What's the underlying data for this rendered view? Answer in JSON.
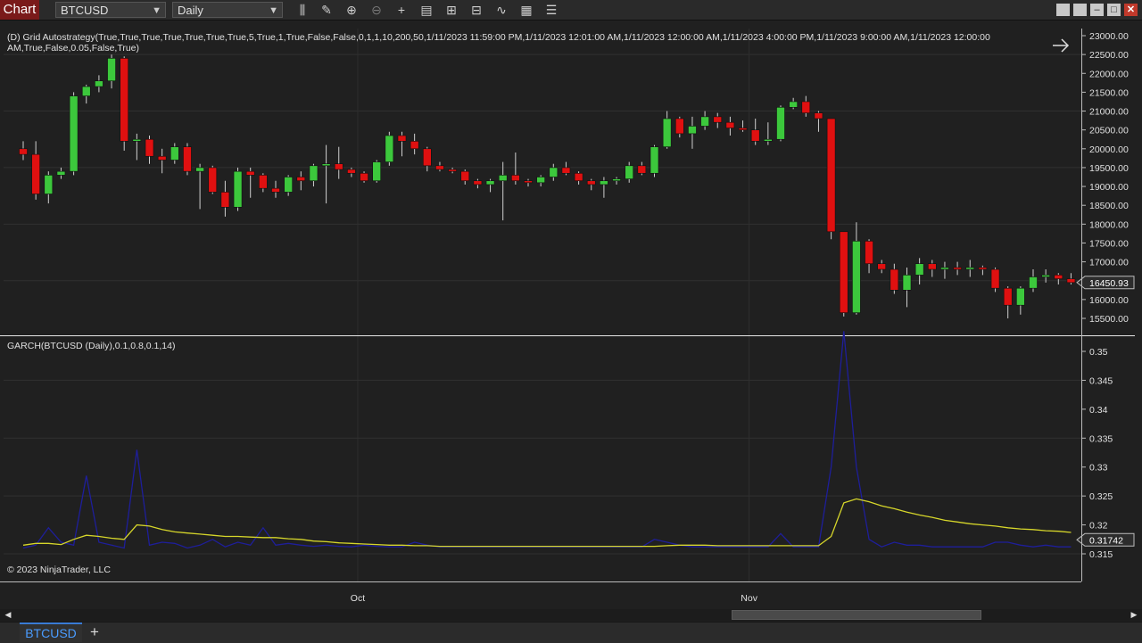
{
  "window": {
    "title": "Chart",
    "instrument": "BTCUSD",
    "interval": "Daily"
  },
  "toolbar": {
    "icons": [
      "bar-type-icon",
      "draw-pencil-icon",
      "zoom-in-icon",
      "zoom-out-icon",
      "crosshair-icon",
      "properties-icon",
      "templates-icon",
      "data-box-icon",
      "indicators-icon",
      "strategies-icon",
      "menu-list-icon"
    ]
  },
  "price_panel": {
    "strategy_label_line1": "(D) Grid Autostrategy(True,True,True,True,True,True,True,5,True,1,True,False,False,0,1,1,10,200,50,1/11/2023 11:59:00 PM,1/11/2023 12:01:00 AM,1/11/2023 12:00:00 AM,1/11/2023 4:00:00 PM,1/11/2023 9:00:00 AM,1/11/2023 12:00:00",
    "strategy_label_line2": "AM,True,False,0.05,False,True)",
    "current_price": "16450.93",
    "y_ticks": [
      "23000.00",
      "22500.00",
      "22000.00",
      "21500.00",
      "21000.00",
      "20500.00",
      "20000.00",
      "19500.00",
      "19000.00",
      "18500.00",
      "18000.00",
      "17500.00",
      "17000.00",
      "16500.00",
      "16000.00",
      "15500.00"
    ]
  },
  "indicator_panel": {
    "label": "GARCH(BTCUSD (Daily),0.1,0.8,0.1,14)",
    "current_value": "0.31742",
    "y_ticks": [
      "0.35",
      "0.345",
      "0.34",
      "0.335",
      "0.33",
      "0.325",
      "0.32",
      "0.315"
    ],
    "copyright": "© 2023 NinjaTrader, LLC"
  },
  "x_axis": {
    "labels": [
      "Oct",
      "Nov"
    ]
  },
  "tabs": {
    "active": "BTCUSD",
    "add": "+"
  },
  "colors": {
    "up": "#3cc83c",
    "down": "#e01010",
    "garch_line": "#1e1e9a",
    "garch_avg": "#d6d62a",
    "accent": "#3a7bd5"
  },
  "chart_data": {
    "type": "candlestick",
    "price": {
      "ylim": [
        15300,
        23100
      ],
      "candles": [
        {
          "o": 20000,
          "h": 20200,
          "l": 19700,
          "c": 19850
        },
        {
          "o": 19850,
          "h": 20200,
          "l": 18650,
          "c": 18800
        },
        {
          "o": 18800,
          "h": 19400,
          "l": 18550,
          "c": 19300
        },
        {
          "o": 19300,
          "h": 19500,
          "l": 19200,
          "c": 19400
        },
        {
          "o": 19400,
          "h": 21500,
          "l": 19300,
          "c": 21400
        },
        {
          "o": 21400,
          "h": 21700,
          "l": 21200,
          "c": 21650
        },
        {
          "o": 21650,
          "h": 21950,
          "l": 21500,
          "c": 21800
        },
        {
          "o": 21800,
          "h": 22500,
          "l": 21600,
          "c": 22400
        },
        {
          "o": 22400,
          "h": 22450,
          "l": 19950,
          "c": 20200
        },
        {
          "o": 20200,
          "h": 20400,
          "l": 19700,
          "c": 20250
        },
        {
          "o": 20250,
          "h": 20350,
          "l": 19600,
          "c": 19800
        },
        {
          "o": 19800,
          "h": 20000,
          "l": 19350,
          "c": 19700
        },
        {
          "o": 19700,
          "h": 20150,
          "l": 19600,
          "c": 20050
        },
        {
          "o": 20050,
          "h": 20150,
          "l": 19300,
          "c": 19400
        },
        {
          "o": 19400,
          "h": 19600,
          "l": 18400,
          "c": 19500
        },
        {
          "o": 19500,
          "h": 19550,
          "l": 18800,
          "c": 18850
        },
        {
          "o": 18850,
          "h": 19150,
          "l": 18200,
          "c": 18450
        },
        {
          "o": 18450,
          "h": 19500,
          "l": 18350,
          "c": 19400
        },
        {
          "o": 19400,
          "h": 19500,
          "l": 18700,
          "c": 19300
        },
        {
          "o": 19300,
          "h": 19350,
          "l": 18850,
          "c": 18950
        },
        {
          "o": 18950,
          "h": 19150,
          "l": 18700,
          "c": 18850
        },
        {
          "o": 18850,
          "h": 19300,
          "l": 18750,
          "c": 19250
        },
        {
          "o": 19250,
          "h": 19400,
          "l": 18900,
          "c": 19150
        },
        {
          "o": 19150,
          "h": 19600,
          "l": 19000,
          "c": 19550
        },
        {
          "o": 19550,
          "h": 20100,
          "l": 18550,
          "c": 19600
        },
        {
          "o": 19600,
          "h": 20050,
          "l": 19200,
          "c": 19450
        },
        {
          "o": 19450,
          "h": 19500,
          "l": 19250,
          "c": 19350
        },
        {
          "o": 19350,
          "h": 19400,
          "l": 19100,
          "c": 19150
        },
        {
          "o": 19150,
          "h": 19700,
          "l": 19100,
          "c": 19650
        },
        {
          "o": 19650,
          "h": 20450,
          "l": 19550,
          "c": 20350
        },
        {
          "o": 20350,
          "h": 20450,
          "l": 19800,
          "c": 20200
        },
        {
          "o": 20200,
          "h": 20400,
          "l": 19850,
          "c": 20000
        },
        {
          "o": 20000,
          "h": 20050,
          "l": 19400,
          "c": 19550
        },
        {
          "o": 19550,
          "h": 19650,
          "l": 19400,
          "c": 19450
        },
        {
          "o": 19450,
          "h": 19500,
          "l": 19350,
          "c": 19400
        },
        {
          "o": 19400,
          "h": 19450,
          "l": 19050,
          "c": 19150
        },
        {
          "o": 19150,
          "h": 19200,
          "l": 18950,
          "c": 19050
        },
        {
          "o": 19050,
          "h": 19200,
          "l": 18850,
          "c": 19150
        },
        {
          "o": 19150,
          "h": 19650,
          "l": 18100,
          "c": 19300
        },
        {
          "o": 19300,
          "h": 19900,
          "l": 19050,
          "c": 19150
        },
        {
          "o": 19150,
          "h": 19200,
          "l": 19000,
          "c": 19100
        },
        {
          "o": 19100,
          "h": 19300,
          "l": 19000,
          "c": 19250
        },
        {
          "o": 19250,
          "h": 19600,
          "l": 19150,
          "c": 19500
        },
        {
          "o": 19500,
          "h": 19650,
          "l": 19300,
          "c": 19350
        },
        {
          "o": 19350,
          "h": 19400,
          "l": 19050,
          "c": 19150
        },
        {
          "o": 19150,
          "h": 19200,
          "l": 18900,
          "c": 19050
        },
        {
          "o": 19050,
          "h": 19250,
          "l": 18700,
          "c": 19150
        },
        {
          "o": 19150,
          "h": 19250,
          "l": 19050,
          "c": 19200
        },
        {
          "o": 19200,
          "h": 19650,
          "l": 19100,
          "c": 19550
        },
        {
          "o": 19550,
          "h": 19650,
          "l": 19300,
          "c": 19350
        },
        {
          "o": 19350,
          "h": 20100,
          "l": 19250,
          "c": 20050
        },
        {
          "o": 20050,
          "h": 21000,
          "l": 20000,
          "c": 20800
        },
        {
          "o": 20800,
          "h": 20850,
          "l": 20300,
          "c": 20400
        },
        {
          "o": 20400,
          "h": 20850,
          "l": 20000,
          "c": 20600
        },
        {
          "o": 20600,
          "h": 21000,
          "l": 20500,
          "c": 20850
        },
        {
          "o": 20850,
          "h": 20950,
          "l": 20550,
          "c": 20700
        },
        {
          "o": 20700,
          "h": 20850,
          "l": 20350,
          "c": 20550
        },
        {
          "o": 20550,
          "h": 20750,
          "l": 20450,
          "c": 20500
        },
        {
          "o": 20500,
          "h": 20800,
          "l": 20100,
          "c": 20200
        },
        {
          "o": 20200,
          "h": 20700,
          "l": 20100,
          "c": 20250
        },
        {
          "o": 20250,
          "h": 21150,
          "l": 20200,
          "c": 21100
        },
        {
          "o": 21100,
          "h": 21350,
          "l": 21050,
          "c": 21250
        },
        {
          "o": 21250,
          "h": 21400,
          "l": 20850,
          "c": 20950
        },
        {
          "o": 20950,
          "h": 21000,
          "l": 20450,
          "c": 20800
        },
        {
          "o": 20800,
          "h": 20800,
          "l": 17600,
          "c": 17800
        },
        {
          "o": 17800,
          "h": 17800,
          "l": 15550,
          "c": 15650
        },
        {
          "o": 15650,
          "h": 18050,
          "l": 15600,
          "c": 17550
        },
        {
          "o": 17550,
          "h": 17600,
          "l": 16700,
          "c": 16950
        },
        {
          "o": 16950,
          "h": 17050,
          "l": 16700,
          "c": 16800
        },
        {
          "o": 16800,
          "h": 16950,
          "l": 16150,
          "c": 16250
        },
        {
          "o": 16250,
          "h": 16850,
          "l": 15800,
          "c": 16650
        },
        {
          "o": 16650,
          "h": 17100,
          "l": 16400,
          "c": 16950
        },
        {
          "o": 16950,
          "h": 17050,
          "l": 16600,
          "c": 16800
        },
        {
          "o": 16800,
          "h": 17000,
          "l": 16550,
          "c": 16850
        },
        {
          "o": 16850,
          "h": 17000,
          "l": 16650,
          "c": 16800
        },
        {
          "o": 16800,
          "h": 17050,
          "l": 16600,
          "c": 16850
        },
        {
          "o": 16850,
          "h": 16900,
          "l": 16650,
          "c": 16800
        },
        {
          "o": 16800,
          "h": 16850,
          "l": 16200,
          "c": 16300
        },
        {
          "o": 16300,
          "h": 16350,
          "l": 15500,
          "c": 15850
        },
        {
          "o": 15850,
          "h": 16350,
          "l": 15600,
          "c": 16300
        },
        {
          "o": 16300,
          "h": 16800,
          "l": 16200,
          "c": 16600
        },
        {
          "o": 16600,
          "h": 16800,
          "l": 16450,
          "c": 16650
        },
        {
          "o": 16650,
          "h": 16700,
          "l": 16400,
          "c": 16550
        },
        {
          "o": 16550,
          "h": 16700,
          "l": 16400,
          "c": 16450
        }
      ]
    },
    "garch": {
      "ylim": [
        0.3125,
        0.3535
      ],
      "volatility": [
        0.316,
        0.3165,
        0.3195,
        0.317,
        0.3165,
        0.3285,
        0.317,
        0.3165,
        0.316,
        0.333,
        0.3165,
        0.317,
        0.3168,
        0.316,
        0.3165,
        0.3175,
        0.3162,
        0.317,
        0.3165,
        0.3195,
        0.3165,
        0.3168,
        0.3165,
        0.3163,
        0.3165,
        0.3163,
        0.3162,
        0.3165,
        0.3163,
        0.3162,
        0.3162,
        0.317,
        0.3165,
        0.3162,
        0.3162,
        0.3162,
        0.3162,
        0.3162,
        0.3162,
        0.3162,
        0.3162,
        0.3162,
        0.3162,
        0.3162,
        0.3162,
        0.3162,
        0.3162,
        0.3162,
        0.3162,
        0.3162,
        0.3175,
        0.317,
        0.3165,
        0.3162,
        0.3162,
        0.3162,
        0.3162,
        0.3162,
        0.3162,
        0.3162,
        0.3185,
        0.3162,
        0.3162,
        0.3162,
        0.33,
        0.3535,
        0.33,
        0.3175,
        0.3162,
        0.317,
        0.3165,
        0.3165,
        0.3162,
        0.3162,
        0.3162,
        0.3162,
        0.3162,
        0.317,
        0.317,
        0.3165,
        0.3162,
        0.3165,
        0.3162,
        0.3162
      ],
      "average": [
        0.3165,
        0.3168,
        0.3168,
        0.3166,
        0.3175,
        0.3182,
        0.318,
        0.3177,
        0.3175,
        0.32,
        0.3198,
        0.3192,
        0.3188,
        0.3186,
        0.3184,
        0.3182,
        0.318,
        0.318,
        0.3179,
        0.3178,
        0.3178,
        0.3176,
        0.3175,
        0.3172,
        0.3171,
        0.3169,
        0.3168,
        0.3167,
        0.3166,
        0.3165,
        0.3165,
        0.3164,
        0.3164,
        0.3163,
        0.3163,
        0.3163,
        0.3163,
        0.3163,
        0.3163,
        0.3163,
        0.3163,
        0.3163,
        0.3163,
        0.3163,
        0.3163,
        0.3163,
        0.3163,
        0.3163,
        0.3163,
        0.3163,
        0.3163,
        0.3164,
        0.3165,
        0.3165,
        0.3165,
        0.3164,
        0.3164,
        0.3164,
        0.3164,
        0.3164,
        0.3164,
        0.3164,
        0.3164,
        0.3164,
        0.318,
        0.3238,
        0.3245,
        0.324,
        0.3233,
        0.3228,
        0.3222,
        0.3217,
        0.3213,
        0.3208,
        0.3205,
        0.3202,
        0.32,
        0.3198,
        0.3195,
        0.3193,
        0.3192,
        0.319,
        0.3189,
        0.3187
      ]
    }
  }
}
